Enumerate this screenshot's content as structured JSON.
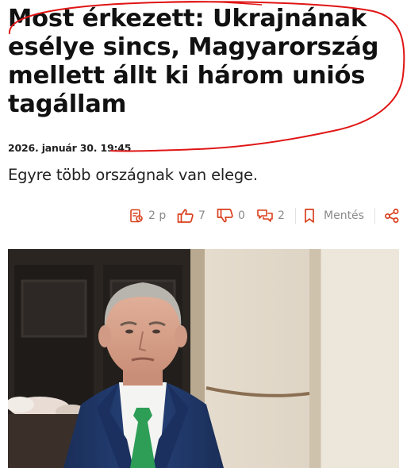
{
  "article": {
    "headline": "Most érkezett: Ukrajnának esélye sincs, Magyarország mellett állt ki három uniós tagállam",
    "date": "2026. január 30. 19:45",
    "lead": "Egyre több országnak van elege."
  },
  "actions": {
    "read_time": "2 p",
    "likes": "7",
    "dislikes": "0",
    "comments": "2",
    "save_label": "Mentés"
  },
  "colors": {
    "accent": "#d9411e",
    "annotation": "#e01515",
    "muted_text": "#8a8a8a",
    "tie": "#2e9e57"
  },
  "icons": [
    "read-time-icon",
    "thumbs-up-icon",
    "thumbs-down-icon",
    "comment-icon",
    "bookmark-icon",
    "share-icon"
  ]
}
